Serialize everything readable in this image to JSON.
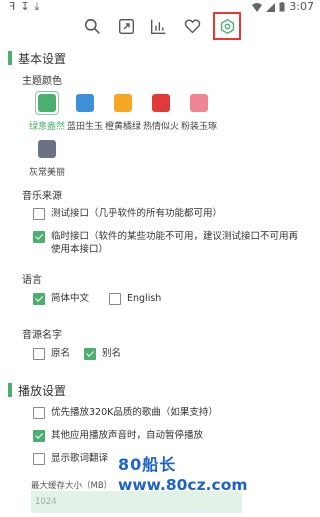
{
  "status_bar": {
    "time": "3:07",
    "left_glyphs": [
      "ꟻ",
      "↧",
      "⤓"
    ]
  },
  "toolbar": {
    "icons": [
      "search-icon",
      "share-icon",
      "chart-icon",
      "heart-icon",
      "settings-icon"
    ],
    "active": "settings-icon"
  },
  "basic": {
    "title": "基本设置",
    "theme": {
      "label": "主题颜色",
      "items": [
        {
          "label": "绿意盎然",
          "color": "#4caf70",
          "selected": true
        },
        {
          "label": "蓝田生玉",
          "color": "#3d8fd8",
          "selected": false
        },
        {
          "label": "橙黄橘绿",
          "color": "#f5a623",
          "selected": false
        },
        {
          "label": "热情似火",
          "color": "#e03a3a",
          "selected": false
        },
        {
          "label": "粉装玉琢",
          "color": "#ef8595",
          "selected": false
        },
        {
          "label": "灰常美丽",
          "color": "#6a7384",
          "selected": false
        }
      ]
    },
    "source": {
      "label": "音乐来源",
      "options": [
        {
          "label": "测试接口（几乎软件的所有功能都可用）",
          "checked": false
        },
        {
          "label": "临时接口（软件的某些功能不可用，建议测试接口不可用再",
          "label2": "使用本接口）",
          "checked": true
        }
      ]
    },
    "language": {
      "label": "语言",
      "options": [
        {
          "label": "简体中文",
          "checked": true
        },
        {
          "label": "English",
          "checked": false
        }
      ]
    },
    "source_name": {
      "label": "音源名字",
      "options": [
        {
          "label": "原名",
          "checked": false
        },
        {
          "label": "别名",
          "checked": true
        }
      ]
    }
  },
  "playback": {
    "title": "播放设置",
    "options": [
      {
        "label": "优先播放320K品质的歌曲（如果支持）",
        "checked": false
      },
      {
        "label": "其他应用播放声音时，自动暂停播放",
        "checked": true
      },
      {
        "label": "显示歌词翻译",
        "checked": false
      }
    ],
    "cache": {
      "label": "最大缓存大小（MB）",
      "placeholder": "1024"
    }
  },
  "watermark": {
    "line1": "80船长",
    "line2": "www.80cz.com"
  }
}
